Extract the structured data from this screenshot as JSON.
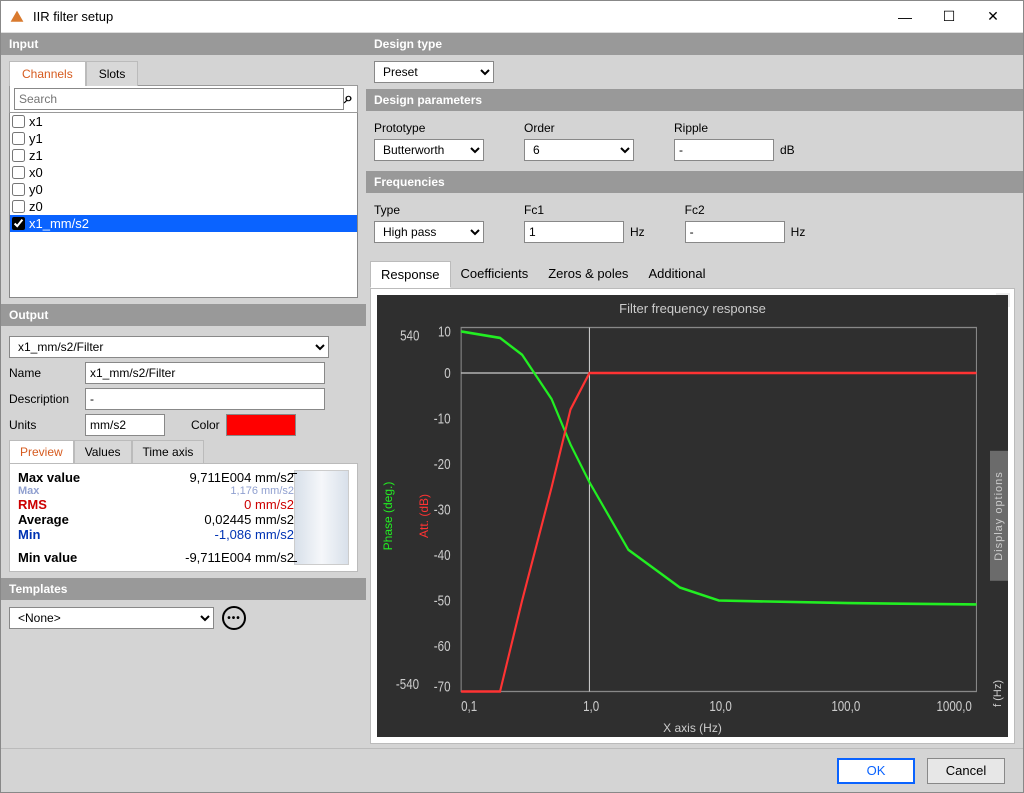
{
  "window": {
    "title": "IIR filter setup"
  },
  "input": {
    "header": "Input",
    "tabs": {
      "channels": "Channels",
      "slots": "Slots"
    },
    "search_placeholder": "Search",
    "channels": [
      "x1",
      "y1",
      "z1",
      "x0",
      "y0",
      "z0",
      "x1_mm/s2"
    ],
    "selected": "x1_mm/s2"
  },
  "output": {
    "header": "Output",
    "selected": "x1_mm/s2/Filter",
    "name_label": "Name",
    "name_value": "x1_mm/s2/Filter",
    "desc_label": "Description",
    "desc_value": "-",
    "units_label": "Units",
    "units_value": "mm/s2",
    "color_label": "Color",
    "subtabs": {
      "preview": "Preview",
      "values": "Values",
      "timeaxis": "Time axis"
    },
    "stats": {
      "maxvalue_label": "Max value",
      "maxvalue": "9,711E004 mm/s2",
      "max_label_over": "Max",
      "max_over": "1,176 mm/s2",
      "rms_label": "RMS",
      "rms": "0 mm/s2",
      "avg_label": "Average",
      "avg": "0,02445 mm/s2",
      "min_label": "Min",
      "min": "-1,086 mm/s2",
      "minvalue_label": "Min value",
      "minvalue": "-9,711E004 mm/s2"
    }
  },
  "templates": {
    "header": "Templates",
    "selected": "<None>"
  },
  "design": {
    "type_header": "Design type",
    "type_value": "Preset",
    "params_header": "Design parameters",
    "prototype_label": "Prototype",
    "prototype_value": "Butterworth",
    "order_label": "Order",
    "order_value": "6",
    "ripple_label": "Ripple",
    "ripple_value": "-",
    "ripple_unit": "dB",
    "freq_header": "Frequencies",
    "ftype_label": "Type",
    "ftype_value": "High pass",
    "fc1_label": "Fc1",
    "fc1_value": "1",
    "fc1_unit": "Hz",
    "fc2_label": "Fc2",
    "fc2_value": "-",
    "fc2_unit": "Hz"
  },
  "chart": {
    "tabs": {
      "response": "Response",
      "coeff": "Coefficients",
      "zeros": "Zeros & poles",
      "additional": "Additional"
    },
    "title": "Filter frequency response",
    "ylabel_phase": "Phase (deg.)",
    "ylabel_att": "Att. (dB)",
    "xlabel": "X axis (Hz)",
    "xticks": [
      "0,1",
      "1,0",
      "10,0",
      "100,0",
      "1000,0"
    ],
    "att_ticks": [
      "10",
      "0",
      "-10",
      "-20",
      "-30",
      "-40",
      "-50",
      "-60",
      "-70"
    ],
    "phase_ticks": [
      "540",
      "-540"
    ],
    "display_options": "Display options",
    "f_unit": "f (Hz)"
  },
  "chart_data": {
    "type": "line",
    "x_log": [
      0.1,
      0.2,
      0.3,
      0.5,
      0.7,
      1.0,
      2.0,
      5.0,
      10,
      100,
      1000
    ],
    "series": [
      {
        "name": "Attenuation (dB)",
        "color": "#ff3030",
        "values": [
          -80,
          -70,
          -50,
          -25,
          -8,
          0,
          0,
          0,
          0,
          0,
          0
        ]
      },
      {
        "name": "Phase (deg)",
        "color": "#30e030",
        "values": [
          530,
          510,
          460,
          330,
          190,
          80,
          -120,
          -230,
          -260,
          -270,
          -270
        ]
      }
    ],
    "xlabel": "f (Hz)",
    "xlim": [
      0.1,
      1000
    ],
    "ylabel_left": "Phase (deg.)",
    "ylim_left": [
      -540,
      540
    ],
    "ylabel_right": "Att. (dB)",
    "ylim_right": [
      -70,
      10
    ],
    "title": "Filter frequency response",
    "cursor_x": 1.0
  },
  "footer": {
    "ok": "OK",
    "cancel": "Cancel"
  }
}
